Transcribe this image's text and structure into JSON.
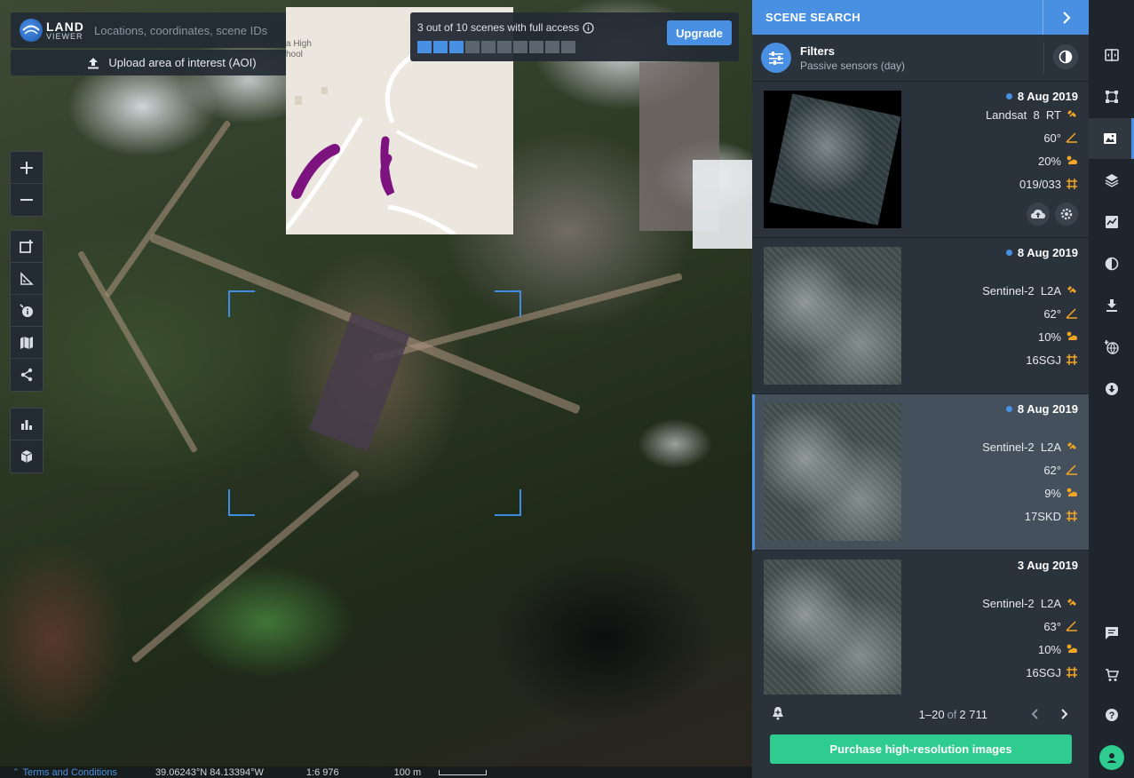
{
  "search": {
    "logo_line1": "LAND",
    "logo_line2": "VIEWER",
    "placeholder": "Locations, coordinates, scene IDs",
    "aoi_label": "Upload area of interest (AOI)"
  },
  "minimap": {
    "label_line1": "a High",
    "label_line2": "hool"
  },
  "access": {
    "text": "3 out of 10 scenes with full access",
    "used": 3,
    "total": 10,
    "upgrade_label": "Upgrade"
  },
  "map_tools": {
    "zoom": [
      "zoom-in",
      "zoom-out"
    ],
    "draw": [
      "add-aoi",
      "measure",
      "pin-info",
      "map-layers",
      "share"
    ],
    "analysis": [
      "statistics",
      "3d-view"
    ]
  },
  "statusbar": {
    "terms_label": "Terms and Conditions",
    "coordinates": "39.06243°N 84.13394°W",
    "scale": "1:6 976",
    "distance": "100 m"
  },
  "panel": {
    "title": "SCENE SEARCH",
    "filters_title": "Filters",
    "filters_subtitle": "Passive sensors (day)",
    "scenes": [
      {
        "date": "8 Aug 2019",
        "new": true,
        "sensor": "Landsat  8  RT",
        "angle": "60°",
        "cloud": "20%",
        "tile": "019/033",
        "selected": false,
        "actions": true
      },
      {
        "date": "8 Aug 2019",
        "new": true,
        "sensor": "Sentinel-2  L2A",
        "angle": "62°",
        "cloud": "10%",
        "tile": "16SGJ",
        "selected": false,
        "actions": false
      },
      {
        "date": "8 Aug 2019",
        "new": true,
        "sensor": "Sentinel-2  L2A",
        "angle": "62°",
        "cloud": "9%",
        "tile": "17SKD",
        "selected": true,
        "actions": false
      },
      {
        "date": "3 Aug 2019",
        "new": false,
        "sensor": "Sentinel-2  L2A",
        "angle": "63°",
        "cloud": "10%",
        "tile": "16SGJ",
        "selected": false,
        "actions": false
      }
    ],
    "pager_range": "1–20",
    "pager_of": "of",
    "pager_total": "2 711",
    "purchase_label": "Purchase high-resolution images"
  },
  "colors": {
    "accent": "#4a90e2",
    "purchase": "#2ecc8f",
    "icon_orange": "#f5a623",
    "panel_bg": "#2a323b",
    "rail_bg": "#1e252d"
  },
  "rail_icons": [
    "compare-icon",
    "aoi-icon",
    "scenes-icon",
    "layers-icon",
    "chart-icon",
    "contrast-icon",
    "download-icon",
    "globe-icon",
    "download-circle-icon",
    "chat-icon",
    "cart-icon",
    "help-icon",
    "user-icon"
  ]
}
